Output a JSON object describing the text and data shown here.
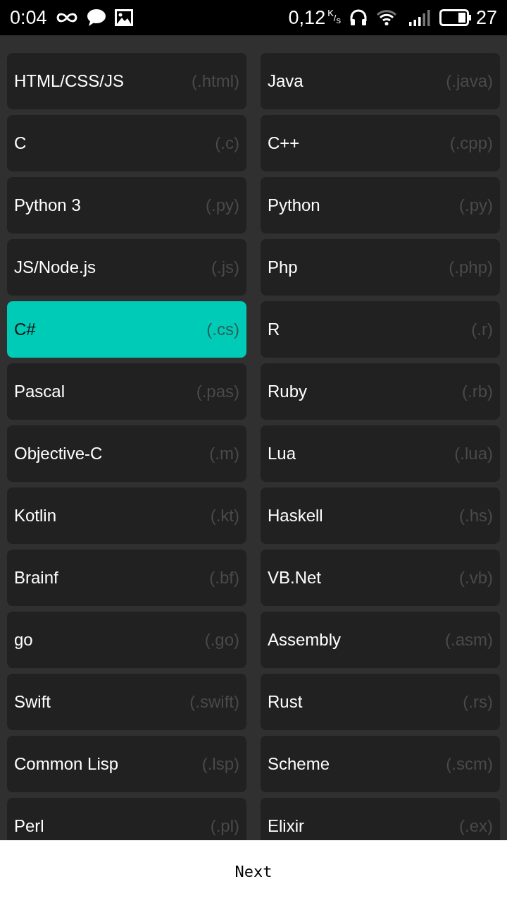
{
  "status_bar": {
    "time": "0:04",
    "network_speed": "0,12",
    "speed_unit": "$^{K}$/$_{s}$",
    "battery": "27"
  },
  "languages": [
    {
      "name": "HTML/CSS/JS",
      "extension": "(.html)",
      "selected": false
    },
    {
      "name": "Java",
      "extension": "(.java)",
      "selected": false
    },
    {
      "name": "C",
      "extension": "(.c)",
      "selected": false
    },
    {
      "name": "C++",
      "extension": "(.cpp)",
      "selected": false
    },
    {
      "name": "Python 3",
      "extension": "(.py)",
      "selected": false
    },
    {
      "name": "Python",
      "extension": "(.py)",
      "selected": false
    },
    {
      "name": "JS/Node.js",
      "extension": "(.js)",
      "selected": false
    },
    {
      "name": "Php",
      "extension": "(.php)",
      "selected": false
    },
    {
      "name": "C#",
      "extension": "(.cs)",
      "selected": true
    },
    {
      "name": "R",
      "extension": "(.r)",
      "selected": false
    },
    {
      "name": "Pascal",
      "extension": "(.pas)",
      "selected": false
    },
    {
      "name": "Ruby",
      "extension": "(.rb)",
      "selected": false
    },
    {
      "name": "Objective-C",
      "extension": "(.m)",
      "selected": false
    },
    {
      "name": "Lua",
      "extension": "(.lua)",
      "selected": false
    },
    {
      "name": "Kotlin",
      "extension": "(.kt)",
      "selected": false
    },
    {
      "name": "Haskell",
      "extension": "(.hs)",
      "selected": false
    },
    {
      "name": "Brainf",
      "extension": "(.bf)",
      "selected": false
    },
    {
      "name": "VB.Net",
      "extension": "(.vb)",
      "selected": false
    },
    {
      "name": "go",
      "extension": "(.go)",
      "selected": false
    },
    {
      "name": "Assembly",
      "extension": "(.asm)",
      "selected": false
    },
    {
      "name": "Swift",
      "extension": "(.swift)",
      "selected": false
    },
    {
      "name": "Rust",
      "extension": "(.rs)",
      "selected": false
    },
    {
      "name": "Common Lisp",
      "extension": "(.lsp)",
      "selected": false
    },
    {
      "name": "Scheme",
      "extension": "(.scm)",
      "selected": false
    },
    {
      "name": "Perl",
      "extension": "(.pl)",
      "selected": false
    },
    {
      "name": "Elixir",
      "extension": "(.ex)",
      "selected": false
    }
  ],
  "next_button": {
    "label": "Next"
  }
}
